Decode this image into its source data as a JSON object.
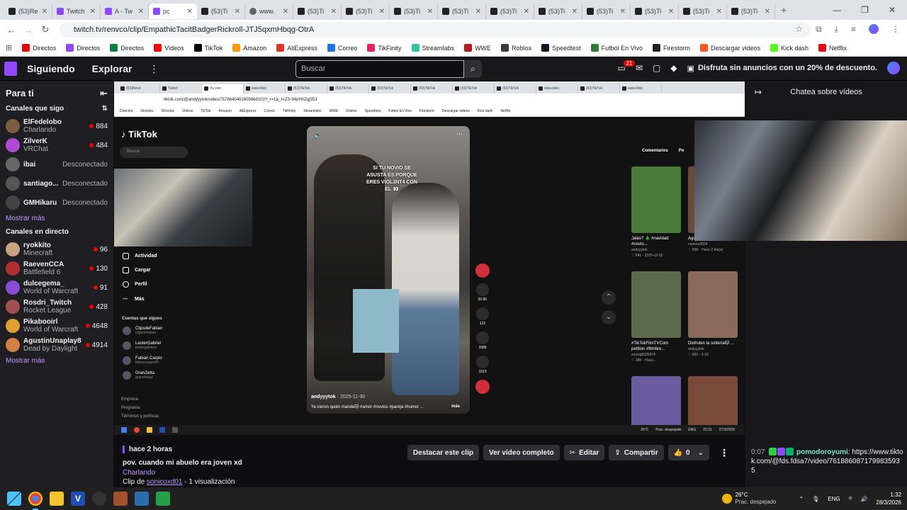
{
  "browser": {
    "tabs": [
      {
        "label": "(53)Re",
        "icon": "tiktok-icon",
        "active": false
      },
      {
        "label": "Twitch",
        "icon": "twitch-icon",
        "active": false
      },
      {
        "label": "A - Tw",
        "icon": "twitch-icon",
        "active": false
      },
      {
        "label": "pc",
        "icon": "twitch-icon",
        "active": true
      },
      {
        "label": "(53)Ti",
        "icon": "tiktok-icon",
        "active": false
      },
      {
        "label": "www.",
        "icon": "globe-icon",
        "active": false
      },
      {
        "label": "(53)Ti",
        "icon": "tiktok-icon",
        "active": false
      },
      {
        "label": "(53)Ti",
        "icon": "tiktok-icon",
        "active": false
      },
      {
        "label": "(53)Ti",
        "icon": "tiktok-icon",
        "active": false
      },
      {
        "label": "(53)Ti",
        "icon": "tiktok-icon",
        "active": false
      },
      {
        "label": "(53)Ti",
        "icon": "tiktok-icon",
        "active": false
      },
      {
        "label": "(53)Ti",
        "icon": "tiktok-icon",
        "active": false
      },
      {
        "label": "(53)Ti",
        "icon": "tiktok-icon",
        "active": false
      },
      {
        "label": "(53)Ti",
        "icon": "tiktok-icon",
        "active": false
      },
      {
        "label": "(53)Ti",
        "icon": "tiktok-icon",
        "active": false
      },
      {
        "label": "(53)Ti",
        "icon": "tiktok-icon",
        "active": false
      }
    ],
    "url": "twitch.tv/renvco/clip/EmpathicTacitBadgerRickroll-JTJ5qxmHbqg-OtrA",
    "bookmarks": [
      {
        "label": "Directos",
        "color": "#eb0400"
      },
      {
        "label": "Directos",
        "color": "#9146ff"
      },
      {
        "label": "Directos",
        "color": "#0b8043"
      },
      {
        "label": "Videos",
        "color": "#ff0000"
      },
      {
        "label": "TikTok",
        "color": "#000000"
      },
      {
        "label": "Amazon",
        "color": "#ff9900"
      },
      {
        "label": "AliExpress",
        "color": "#e43225"
      },
      {
        "label": "Correo",
        "color": "#1a73e8"
      },
      {
        "label": "TikFinity",
        "color": "#e91e63"
      },
      {
        "label": "Streamlabs",
        "color": "#31c3a2"
      },
      {
        "label": "WWE",
        "color": "#b71c1c"
      },
      {
        "label": "Roblox",
        "color": "#393b3d"
      },
      {
        "label": "Speedtest",
        "color": "#141526"
      },
      {
        "label": "Futbol En Vivo",
        "color": "#2e7d32"
      },
      {
        "label": "Firestorm",
        "color": "#222222"
      },
      {
        "label": "Descargar videos",
        "color": "#ff5722"
      },
      {
        "label": "Kick dash",
        "color": "#53fc18"
      },
      {
        "label": "Netflix",
        "color": "#e50914"
      }
    ]
  },
  "twitch_header": {
    "following": "Siguiendo",
    "browse": "Explorar",
    "search_placeholder": "Buscar",
    "notif_count": "21",
    "promo": "Disfruta sin anuncios con un 20% de descuento."
  },
  "sidebar": {
    "for_you": "Para ti",
    "followed_heading": "Canales que sigo",
    "followed": [
      {
        "name": "ElFedelobo",
        "game": "Charlando",
        "viewers": "884",
        "live": true,
        "color": "#7a5c3e"
      },
      {
        "name": "ZilverK",
        "game": "VRChat",
        "viewers": "484",
        "live": true,
        "color": "#b04bd6"
      },
      {
        "name": "ibai",
        "game": "",
        "viewers": "Desconectado",
        "live": false,
        "color": "#666666"
      },
      {
        "name": "santiago...",
        "game": "",
        "viewers": "Desconectado",
        "live": false,
        "color": "#555555"
      },
      {
        "name": "GMHikaru",
        "game": "",
        "viewers": "Desconectado",
        "live": false,
        "color": "#444444"
      }
    ],
    "show_more_1": "Mostrar más",
    "live_heading": "Canales en directo",
    "live": [
      {
        "name": "ryokkito",
        "game": "Minecraft",
        "viewers": "96",
        "color": "#c9a27e"
      },
      {
        "name": "RaevenCCA",
        "game": "Battlefield 6",
        "viewers": "130",
        "color": "#b03030"
      },
      {
        "name": "dulcegema_",
        "game": "World of Warcraft",
        "viewers": "91",
        "color": "#8a4bd6"
      },
      {
        "name": "Rosdri_Twitch",
        "game": "Rocket League",
        "viewers": "428",
        "color": "#a05050"
      },
      {
        "name": "Pikabooirl",
        "game": "World of Warcraft",
        "viewers": "4648",
        "color": "#e0a030"
      },
      {
        "name": "AgustinUnaplay8",
        "game": "Dead by Daylight",
        "viewers": "4914",
        "color": "#d08040"
      }
    ],
    "show_more_2": "Mostrar más"
  },
  "inner_browser": {
    "url": "tiktok.com/@andyyytok/video/7578640481605668103?_r=1&_t=ZS-94jrHhZqj353",
    "bookmarks": [
      "Directos",
      "Directos",
      "Directos",
      "Videos",
      "TikTok",
      "Amazon",
      "AliExpress",
      "Correo",
      "TikFinity",
      "Streamlabs",
      "WWE",
      "Roblox",
      "Speedtest",
      "Futbol En Vivo",
      "Firestorm",
      "Descargar videos",
      "Kick dash",
      "Netflix"
    ],
    "tabs": [
      "(53)Revo",
      "Twitch",
      "Ya vien",
      "www.tikto",
      "(53)TikTok",
      "(53)TikTok",
      "(53)TikTok",
      "(53)TikTok",
      "(53)TikTok",
      "(53)TikTok",
      "www.tikto",
      "(53)TikTok",
      "www.tikto"
    ]
  },
  "tiktok": {
    "logo": "TikTok",
    "search": "Buscar",
    "menu": [
      "Actividad",
      "Cargar",
      "Perfil",
      "Más"
    ],
    "following_heading": "Cuentas que sigues",
    "following": [
      {
        "name": "ClipsdeFabian",
        "handle": "clipsdefabian"
      },
      {
        "name": "LesterGabriel",
        "handle": "lestergabrieel"
      },
      {
        "name": "Fabian Carpio",
        "handle": "fabiancarpio05"
      },
      {
        "name": "GranZetta",
        "handle": "granzettayt"
      }
    ],
    "footer": [
      "Empresa",
      "Programa",
      "Términos y políticas"
    ],
    "video": {
      "caption": "SI TU NOVIO SE ASUSTA ES PORQUE ERES VIOL3NT4 CON EL 👀",
      "author": "andyyytok",
      "date": "· 2025-11-30",
      "description": "Ya vieron quién manda🐱 #amor #novios #pareja #humor ...",
      "more": "más"
    },
    "actions": [
      "20.9K",
      "122",
      "1586",
      "1013"
    ],
    "right_tabs": [
      "Comentarios",
      "Po"
    ],
    "thumbs": [
      {
        "title": "Jalas? 🎄 #navidad #novio...",
        "user": "andyyytok",
        "stats": "♡ 641 · 2025-12-25",
        "color": "#4a7a3a"
      },
      {
        "title": "Agustín... Isidro. PARTE...",
        "user": "nowora2824",
        "stats": "♡ 50K · Hace 2 día(s)",
        "color": "#6b4a3a"
      },
      {
        "title": "#TikTokFilmTVCom petition #filmbre...",
        "user": "zrvzvg8335874",
        "stats": "♡ 18K · Hace...",
        "color": "#5a6a4a"
      },
      {
        "title": "Disfruten la soltería🐱 ...",
        "user": "andyyytok",
        "stats": "♡ 892 · 3-16",
        "color": "#8a6a5a"
      },
      {
        "title": "",
        "user": "",
        "stats": "",
        "color": "#6a5aa0"
      },
      {
        "title": "",
        "user": "",
        "stats": "",
        "color": "#7a4a3a"
      }
    ],
    "taskbar": {
      "temp": "26°C",
      "weather": "Prac. despejado",
      "lang": "ENG",
      "time": "23:31",
      "date": "27/3/2026"
    }
  },
  "right_panel": {
    "title": "Chatea sobre vídeos",
    "chat": {
      "time": "0:07",
      "user": "pomodoroyumi",
      "message": "https://www.tiktok.com/@fds.fdsa7/video/7618860871799835935"
    }
  },
  "clip_info": {
    "ago": "hace 2 horas",
    "title": "pov. cuando mi abuelo era joven xd",
    "category": "Charlando",
    "clip_by": "Clip de",
    "author": "sonicoxd01",
    "views": " - 1 visualización",
    "buttons": {
      "highlight": "Destacar este clip",
      "full": "Ver vídeo completo",
      "edit": "Editar",
      "share": "Compartir",
      "likes": "0"
    }
  },
  "taskbar": {
    "temp": "26°C",
    "weather": "Prac. despejado",
    "lang": "ENG",
    "time": "1:32",
    "date": "28/3/2026"
  }
}
